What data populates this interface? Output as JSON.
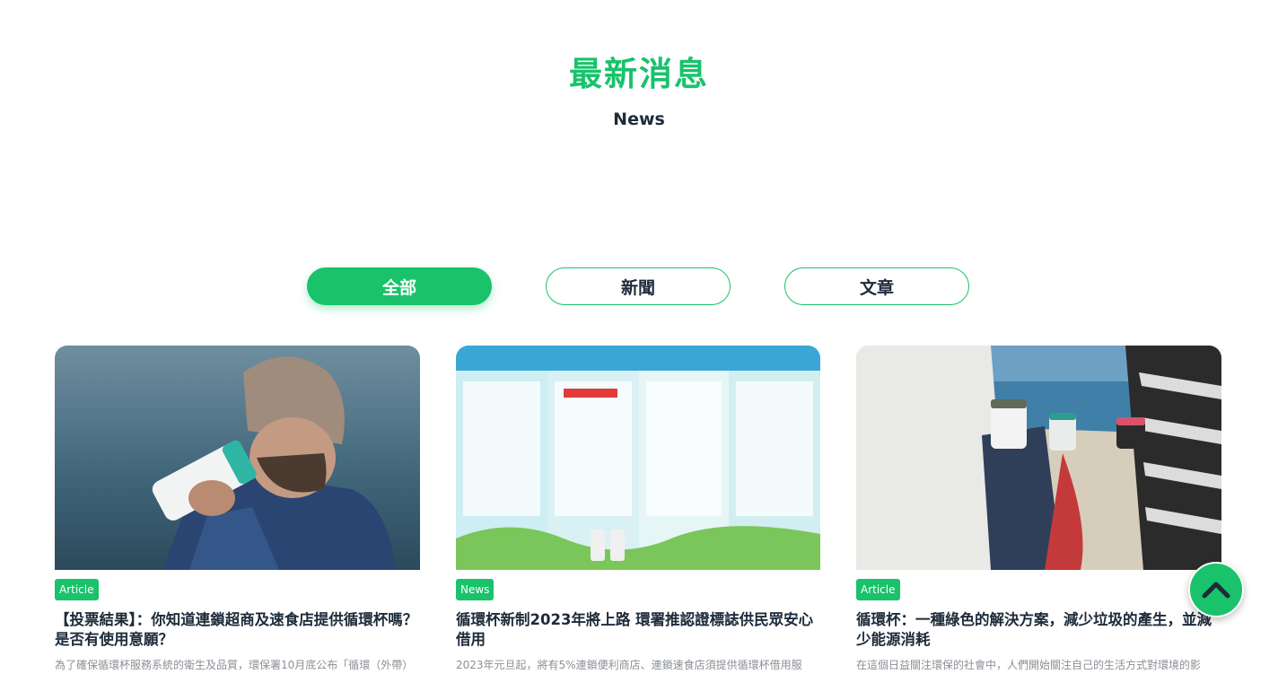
{
  "header": {
    "title": "最新消息",
    "subtitle": "News"
  },
  "filters": {
    "all": "全部",
    "news": "新聞",
    "article": "文章",
    "active": "all"
  },
  "cards": [
    {
      "tag": "Article",
      "title": "【投票結果】：你知道連鎖超商及速食店提供循環杯嗎？是否有使用意願？",
      "excerpt": "為了確保循環杯服務系統的衛生及品質，環保署10月底公布「循環（外帶）"
    },
    {
      "tag": "News",
      "title": "循環杯新制2023年將上路 環署推認證標誌供民眾安心借用",
      "excerpt": "2023年元旦起，將有5%連鎖便利商店、連鎖速食店須提供循環杯借用服"
    },
    {
      "tag": "Article",
      "title": "循環杯：一種綠色的解決方案，減少垃圾的產生，並減少能源消耗",
      "excerpt": "在這個日益關注環保的社會中，人們開始關注自己的生活方式對環境的影"
    }
  ],
  "colors": {
    "brand_green": "#19c26b",
    "text_dark": "#1d2b3a",
    "text_muted": "#8a8f95"
  },
  "scroll_top_icon": "chevron-up-icon"
}
